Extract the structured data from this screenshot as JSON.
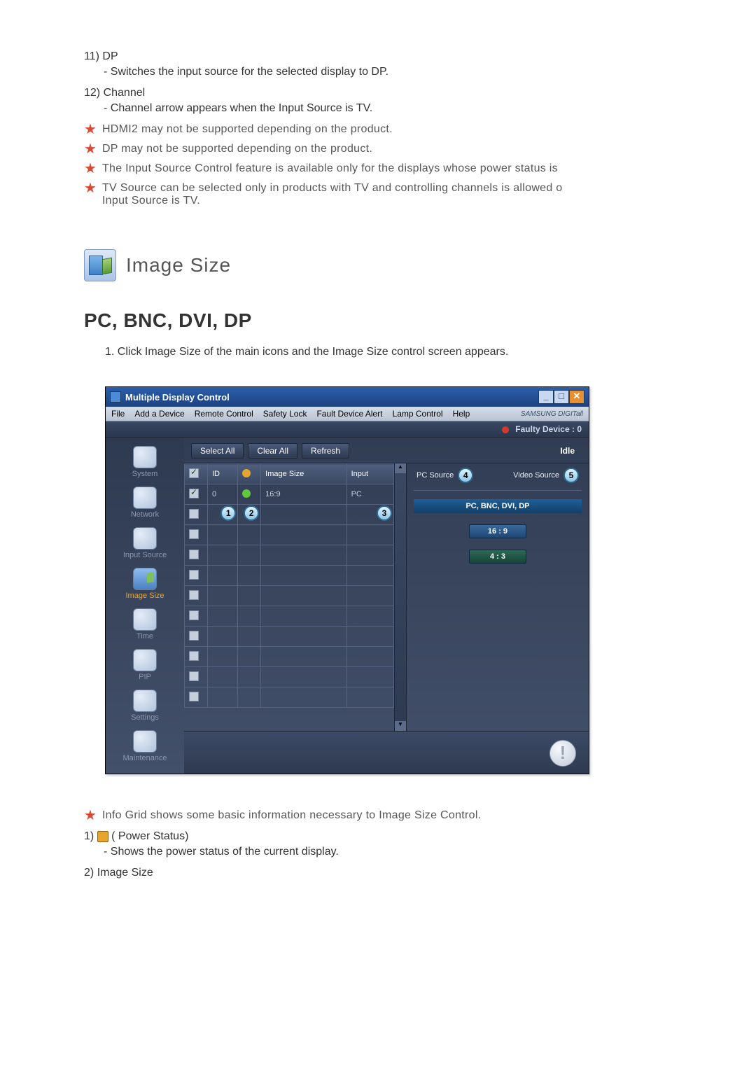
{
  "top_list": [
    {
      "num": "11)",
      "title": "DP",
      "sub": "- Switches the input source for the selected display to DP."
    },
    {
      "num": "12)",
      "title": "Channel",
      "sub": "- Channel arrow appears when the Input Source is TV."
    }
  ],
  "notes": [
    "HDMI2 may not be supported depending on the product.",
    "DP may not be supported depending on the product.",
    "The Input Source Control feature is available only for the displays whose power status is",
    "TV Source can be selected only in products with TV and controlling channels is allowed o\nInput Source is TV."
  ],
  "section_title": "Image Size",
  "subsection_title": "PC, BNC, DVI, DP",
  "step1": "1. Click Image Size of the main icons and the Image Size control screen appears.",
  "app": {
    "title": "Multiple Display Control",
    "menus": [
      "File",
      "Add a Device",
      "Remote Control",
      "Safety Lock",
      "Fault Device Alert",
      "Lamp Control",
      "Help"
    ],
    "brand": "SAMSUNG DIGITall",
    "faulty": "Faulty Device : 0",
    "toolbar": {
      "select_all": "Select All",
      "clear_all": "Clear All",
      "refresh": "Refresh",
      "idle": "Idle"
    },
    "sidebar": [
      "System",
      "Network",
      "Input Source",
      "Image Size",
      "Time",
      "PIP",
      "Settings",
      "Maintenance"
    ],
    "sidebar_active": 3,
    "table": {
      "headers": {
        "id": "ID",
        "image_size": "Image Size",
        "input": "Input"
      },
      "row0": {
        "id": "0",
        "image_size": "16:9",
        "input": "PC"
      }
    },
    "right": {
      "pc_source": "PC Source",
      "video_source": "Video Source",
      "cat": "PC, BNC, DVI, DP",
      "ratio1": "16 : 9",
      "ratio2": "4 : 3"
    },
    "bubbles": {
      "b1": "1",
      "b2": "2",
      "b3": "3",
      "b4": "4",
      "b5": "5"
    }
  },
  "bottom_note": "Info Grid shows some basic information necessary to Image Size Control.",
  "bottom_list": [
    {
      "num": "1)",
      "title_prefix": " ( Power Status)",
      "sub": "- Shows the power status of the current display."
    },
    {
      "num": "2)",
      "title_prefix": "Image Size",
      "sub": ""
    }
  ]
}
